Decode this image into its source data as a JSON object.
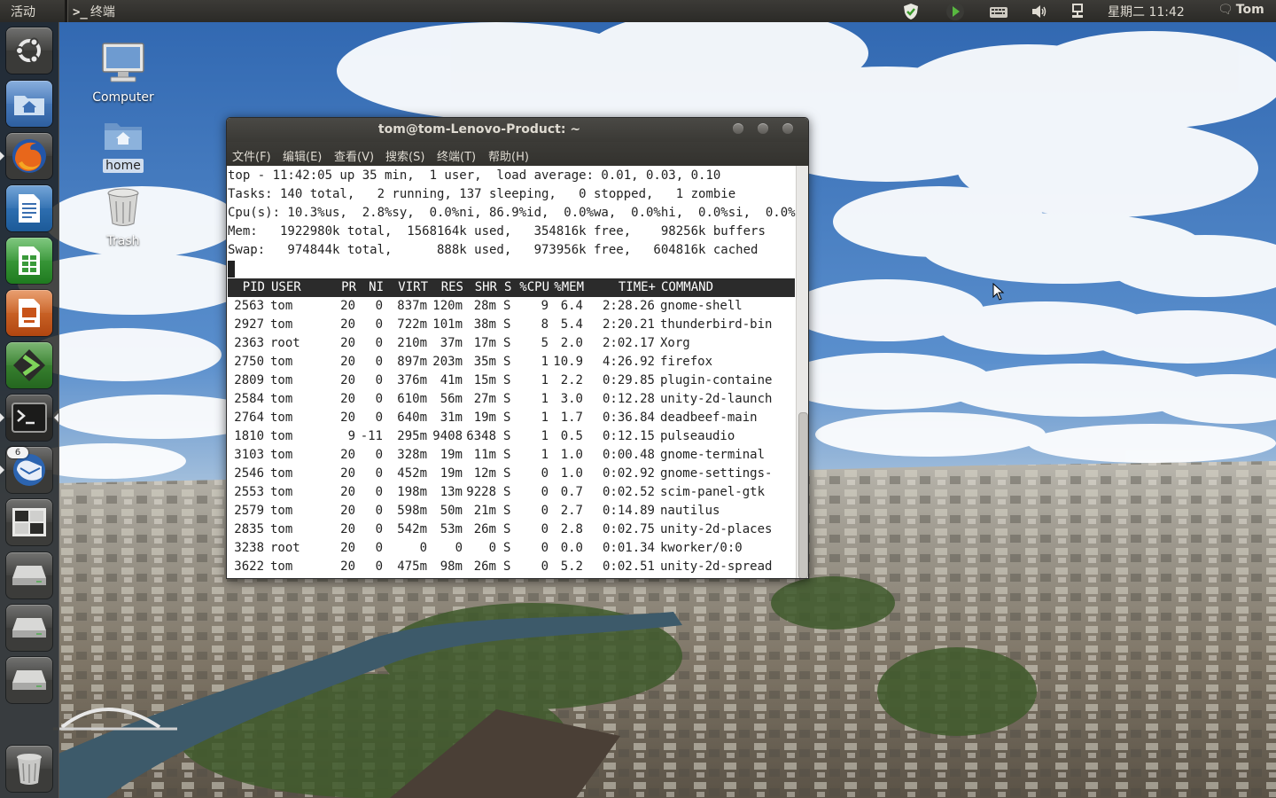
{
  "top_panel": {
    "activities": "活动",
    "app_prompt": ">_",
    "app_name": "终端",
    "clock": "星期二 11:42",
    "user": "Tom",
    "tray_icons": [
      "shield-check-icon",
      "play-arrow-icon",
      "keyboard-icon",
      "volume-icon",
      "network-icon"
    ]
  },
  "launcher": {
    "items": [
      {
        "name": "dash-home",
        "icon": "ubuntu-logo-icon",
        "color": "#3a3a38"
      },
      {
        "name": "home-folder",
        "icon": "folder-home-icon",
        "color": "#3e71b5"
      },
      {
        "name": "firefox",
        "icon": "firefox-icon",
        "color": "#d2521a"
      },
      {
        "name": "writer",
        "icon": "document-icon",
        "color": "#1f67a8"
      },
      {
        "name": "calc",
        "icon": "spreadsheet-icon",
        "color": "#2e9a2e"
      },
      {
        "name": "impress",
        "icon": "presentation-icon",
        "color": "#c9541a"
      },
      {
        "name": "software-center",
        "icon": "green-arrow-icon",
        "color": "#2f7a2a"
      },
      {
        "name": "terminal",
        "icon": "terminal-icon",
        "color": "#2a2a2a"
      },
      {
        "name": "thunderbird",
        "icon": "thunderbird-icon",
        "color": "#2c5e9e"
      },
      {
        "name": "workspace-switcher",
        "icon": "workspaces-icon",
        "color": "#3c3c3a"
      },
      {
        "name": "drive-1",
        "icon": "drive-icon",
        "color": "#3c3c3a"
      },
      {
        "name": "drive-2",
        "icon": "drive-icon",
        "color": "#3c3c3a"
      },
      {
        "name": "drive-3",
        "icon": "drive-icon",
        "color": "#3c3c3a"
      },
      {
        "name": "trash",
        "icon": "trash-icon",
        "color": "#3c3c3a"
      }
    ],
    "thunderbird_badge": "6"
  },
  "desktop": {
    "icons": [
      {
        "name": "computer",
        "icon": "computer-icon",
        "label": "Computer"
      },
      {
        "name": "home",
        "icon": "folder-home-icon",
        "label": "home"
      },
      {
        "name": "trash",
        "icon": "trash-icon",
        "label": "Trash"
      }
    ]
  },
  "terminal": {
    "title": "tom@tom-Lenovo-Product: ~",
    "menu": [
      "文件(F)",
      "编辑(E)",
      "查看(V)",
      "搜索(S)",
      "终端(T)",
      "帮助(H)"
    ],
    "summary": [
      "top - 11:42:05 up 35 min,  1 user,  load average: 0.01, 0.03, 0.10",
      "Tasks: 140 total,   2 running, 137 sleeping,   0 stopped,   1 zombie",
      "Cpu(s): 10.3%us,  2.8%sy,  0.0%ni, 86.9%id,  0.0%wa,  0.0%hi,  0.0%si,  0.0%st",
      "Mem:   1922980k total,  1568164k used,   354816k free,    98256k buffers",
      "Swap:   974844k total,      888k used,   973956k free,   604816k cached"
    ],
    "columns": [
      "PID",
      "USER",
      "PR",
      "NI",
      "VIRT",
      "RES",
      "SHR",
      "S",
      "%CPU",
      "%MEM",
      "TIME+",
      "COMMAND"
    ],
    "processes": [
      [
        "2563",
        "tom",
        "20",
        "0",
        "837m",
        "120m",
        "28m",
        "S",
        "9",
        "6.4",
        "2:28.26",
        "gnome-shell"
      ],
      [
        "2927",
        "tom",
        "20",
        "0",
        "722m",
        "101m",
        "38m",
        "S",
        "8",
        "5.4",
        "2:20.21",
        "thunderbird-bin"
      ],
      [
        "2363",
        "root",
        "20",
        "0",
        "210m",
        "37m",
        "17m",
        "S",
        "5",
        "2.0",
        "2:02.17",
        "Xorg"
      ],
      [
        "2750",
        "tom",
        "20",
        "0",
        "897m",
        "203m",
        "35m",
        "S",
        "1",
        "10.9",
        "4:26.92",
        "firefox"
      ],
      [
        "2809",
        "tom",
        "20",
        "0",
        "376m",
        "41m",
        "15m",
        "S",
        "1",
        "2.2",
        "0:29.85",
        "plugin-containe"
      ],
      [
        "2584",
        "tom",
        "20",
        "0",
        "610m",
        "56m",
        "27m",
        "S",
        "1",
        "3.0",
        "0:12.28",
        "unity-2d-launch"
      ],
      [
        "2764",
        "tom",
        "20",
        "0",
        "640m",
        "31m",
        "19m",
        "S",
        "1",
        "1.7",
        "0:36.84",
        "deadbeef-main"
      ],
      [
        "1810",
        "tom",
        "9",
        "-11",
        "295m",
        "9408",
        "6348",
        "S",
        "1",
        "0.5",
        "0:12.15",
        "pulseaudio"
      ],
      [
        "3103",
        "tom",
        "20",
        "0",
        "328m",
        "19m",
        "11m",
        "S",
        "1",
        "1.0",
        "0:00.48",
        "gnome-terminal"
      ],
      [
        "2546",
        "tom",
        "20",
        "0",
        "452m",
        "19m",
        "12m",
        "S",
        "0",
        "1.0",
        "0:02.92",
        "gnome-settings-"
      ],
      [
        "2553",
        "tom",
        "20",
        "0",
        "198m",
        "13m",
        "9228",
        "S",
        "0",
        "0.7",
        "0:02.52",
        "scim-panel-gtk"
      ],
      [
        "2579",
        "tom",
        "20",
        "0",
        "598m",
        "50m",
        "21m",
        "S",
        "0",
        "2.7",
        "0:14.89",
        "nautilus"
      ],
      [
        "2835",
        "tom",
        "20",
        "0",
        "542m",
        "53m",
        "26m",
        "S",
        "0",
        "2.8",
        "0:02.75",
        "unity-2d-places"
      ],
      [
        "3238",
        "root",
        "20",
        "0",
        "0",
        "0",
        "0",
        "S",
        "0",
        "0.0",
        "0:01.34",
        "kworker/0:0"
      ],
      [
        "3622",
        "tom",
        "20",
        "0",
        "475m",
        "98m",
        "26m",
        "S",
        "0",
        "5.2",
        "0:02.51",
        "unity-2d-spread"
      ]
    ]
  }
}
